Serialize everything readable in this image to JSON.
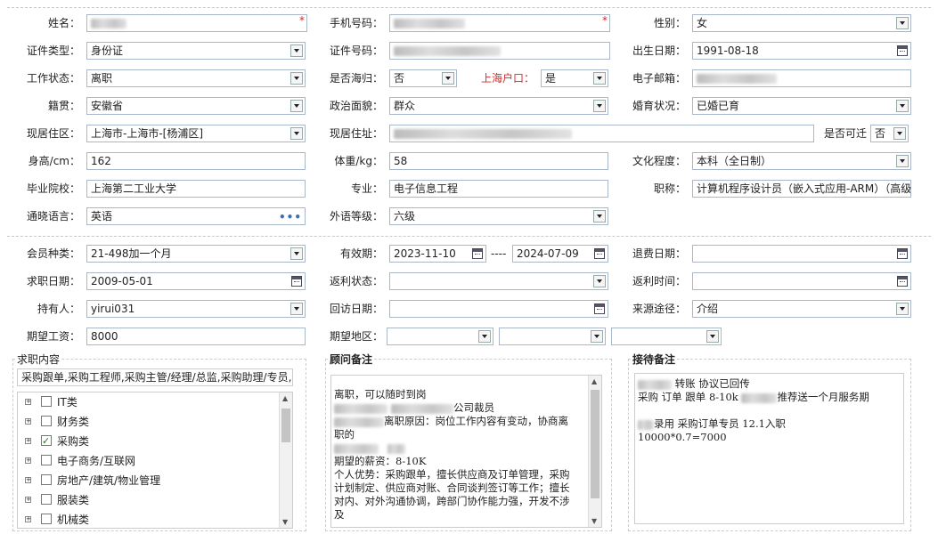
{
  "basic": {
    "name_label": "姓名：",
    "phone_label": "手机号码：",
    "gender_label": "性别：",
    "gender_value": "女",
    "idtype_label": "证件类型：",
    "idtype_value": "身份证",
    "idno_label": "证件号码：",
    "birth_label": "出生日期：",
    "birth_value": "1991-08-18",
    "work_label": "工作状态：",
    "work_value": "离职",
    "returnee_label": "是否海归：",
    "returnee_value": "否",
    "hukou_label": "上海户口：",
    "hukou_value": "是",
    "email_label": "电子邮箱：",
    "native_label": "籍贯：",
    "native_value": "安徽省",
    "political_label": "政治面貌：",
    "political_value": "群众",
    "marital_label": "婚育状况：",
    "marital_value": "已婚已育",
    "district_label": "现居住区：",
    "district_value": "上海市-上海市-[杨浦区]",
    "address_label": "现居住址：",
    "relocate_label": "是否可迁",
    "relocate_value": "否",
    "height_label": "身高/cm：",
    "height_value": "162",
    "weight_label": "体重/kg：",
    "weight_value": "58",
    "edu_label": "文化程度：",
    "edu_value": "本科（全日制）",
    "school_label": "毕业院校：",
    "school_value": "上海第二工业大学",
    "major_label": "专业：",
    "major_value": "电子信息工程",
    "title_label": "职称：",
    "title_value": "计算机程序设计员（嵌入式应用-ARM）（高级",
    "lang_label": "通晓语言：",
    "lang_value": "英语",
    "flevel_label": "外语等级：",
    "flevel_value": "六级",
    "required_mark": "*",
    "ellipsis": "•••"
  },
  "member": {
    "type_label": "会员种类：",
    "type_value": "21-498加一个月",
    "valid_label": "有效期：",
    "valid_from": "2023-11-10",
    "valid_sep": "----",
    "valid_to": "2024-07-09",
    "refund_label": "退费日期：",
    "apply_label": "求职日期：",
    "apply_value": "2009-05-01",
    "rebate_status_label": "返利状态：",
    "rebate_time_label": "返利时间：",
    "holder_label": "持有人：",
    "holder_value": "yirui031",
    "visit_label": "回访日期：",
    "source_label": "来源途径：",
    "source_value": "介绍",
    "salary_label": "期望工资：",
    "salary_value": "8000",
    "region_label": "期望地区："
  },
  "job_panel": {
    "title": "求职内容",
    "summary": "采购跟单,采购工程师,采购主管/经理/总监,采购助理/专员,仓",
    "items": [
      {
        "label": "IT类",
        "checked": false
      },
      {
        "label": "财务类",
        "checked": false
      },
      {
        "label": "采购类",
        "checked": true
      },
      {
        "label": "电子商务/互联网",
        "checked": false
      },
      {
        "label": "房地产/建筑/物业管理",
        "checked": false
      },
      {
        "label": "服装类",
        "checked": false
      },
      {
        "label": "机械类",
        "checked": false
      }
    ]
  },
  "consult_panel": {
    "title": "顾问备注",
    "line1": "离职，可以随时到岗",
    "line2": "公司裁员",
    "line3": "离职原因：岗位工作内容有变动，协商离",
    "line4": "职的",
    "line5": "期望的薪资：8-10K",
    "line6": "个人优势：采购跟单，擅长供应商及订单管理，采购",
    "line7": "计划制定、供应商对账、合同谈判签订等工作；擅长",
    "line8": "对内、对外沟通协调，跨部门协作能力强，开发不涉",
    "line9": "及"
  },
  "reception_panel": {
    "title": "接待备注",
    "line1": "转账 协议已回传",
    "line2a": "采购 订单 跟单  8-10k",
    "line2b": "推荐送一个月服务期",
    "line3a": "录用  采购订单专员  12.1入职",
    "line4": "10000*0.7=7000"
  }
}
